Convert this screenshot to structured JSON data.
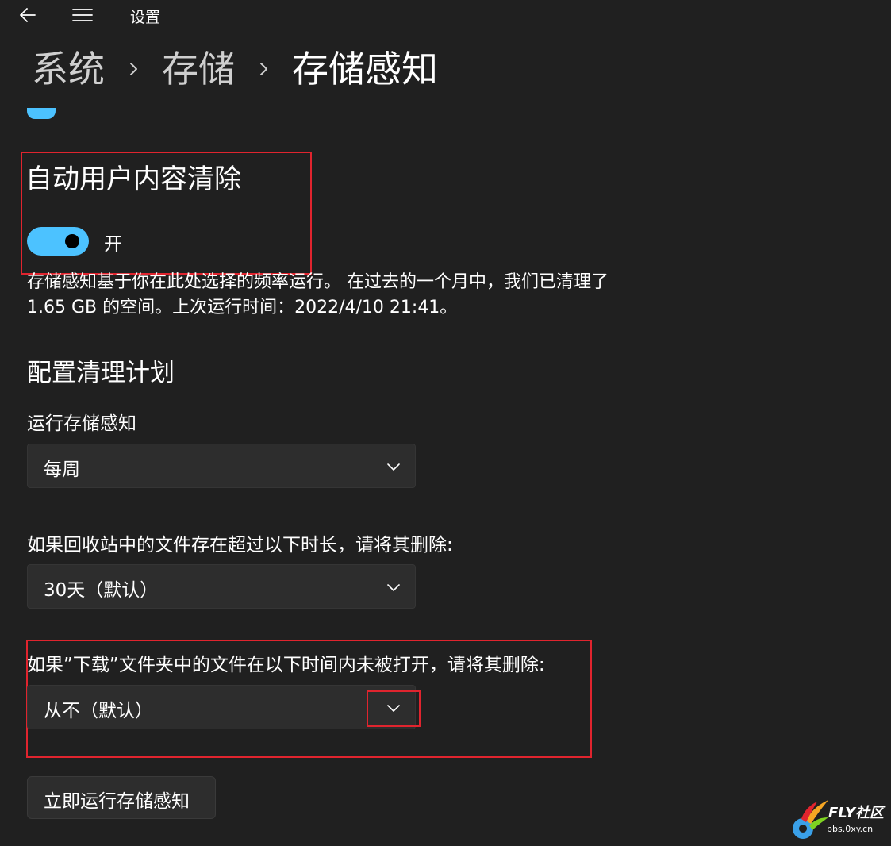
{
  "app": {
    "title": "设置"
  },
  "breadcrumb": {
    "items": [
      "系统",
      "存储",
      "存储感知"
    ]
  },
  "colors": {
    "background": "#202020",
    "accent": "#4cc2ff",
    "annotation": "#e0242e"
  },
  "auto_cleanup": {
    "heading": "自动用户内容清除",
    "toggle_state": "开",
    "toggle_on": true,
    "description": "存储感知基于你在此处选择的频率运行。 在过去的一个月中，我们已清理了 1.65 GB 的空间。上次运行时间：2022/4/10 21:41。"
  },
  "schedule": {
    "heading": "配置清理计划",
    "run_label": "运行存储感知",
    "run_value": "每周",
    "recycle_label": "如果回收站中的文件存在超过以下时长，请将其删除:",
    "recycle_value": "30天（默认）",
    "downloads_label": "如果”下载”文件夹中的文件在以下时间内未被打开，请将其删除:",
    "downloads_value": "从不（默认）"
  },
  "run_now_button": "立即运行存储感知",
  "icons": {
    "back": "back-arrow-icon",
    "menu": "hamburger-menu-icon",
    "separator": "chevron-right-icon",
    "dropdown": "chevron-down-icon"
  },
  "watermark": {
    "title": "FLY社区",
    "url": "bbs.0xy.cn"
  }
}
